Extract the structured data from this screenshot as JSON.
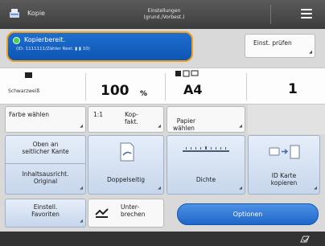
{
  "titlebar": {
    "app_title": "Kopie",
    "settings_label": "Einstellungen (grund./Vorbest.)"
  },
  "status": {
    "title": "Kopierbereit.",
    "detail": "(ID: 1111111/Zähler Rest: ▮ ▮ 10)",
    "check_button": "Einst. prüfen"
  },
  "settings": {
    "color_mode": "Schwarzweiß",
    "zoom_value": "100",
    "zoom_unit": "%",
    "paper_size": "A4",
    "copies": "1"
  },
  "buttons": {
    "farbe": "Farbe wählen",
    "ratio_a": "1:1",
    "ratio_b": "Kop-\nfakt.",
    "papier": "Papier\nwählen",
    "oben": "Oben an\nseitlicher Kante",
    "inhalt": "Inhaltsausricht.\nOriginal",
    "doppel": "Doppelseitig",
    "dichte": "Dichte",
    "idkarte": "ID Karte\nkopieren",
    "favoriten": "Einstell.\nFavoriten",
    "unterbrechen": "Unter-\nbrechen",
    "optionen": "Optionen"
  },
  "colors": {
    "titlebar": "#4a4a4a",
    "status_box": "#1560c4",
    "status_border": "#f0a020",
    "accent_blue": "#2a74d6"
  },
  "icons": {
    "app": "copier-icon",
    "menu": "hamburger-menu-icon",
    "footer": "counter-check-icon"
  }
}
